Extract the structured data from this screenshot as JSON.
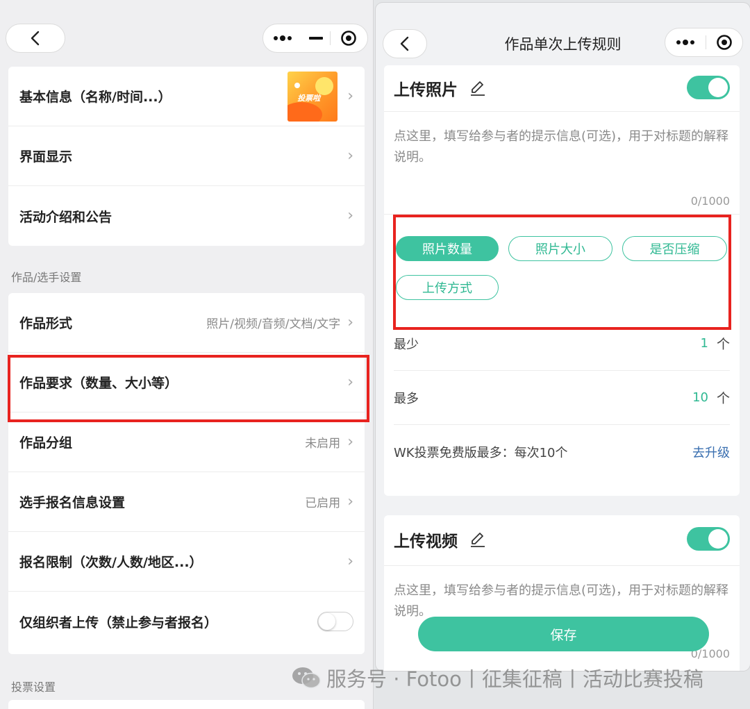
{
  "left_screen": {
    "basic_section": {
      "rows": [
        {
          "title": "基本信息（名称/时间...）"
        },
        {
          "title": "界面显示"
        },
        {
          "title": "活动介绍和公告"
        }
      ],
      "thumbnail_text": "投票啦"
    },
    "works_section_label": "作品/选手设置",
    "works_section": {
      "rows": [
        {
          "title": "作品形式",
          "value": "照片/视频/音频/文档/文字"
        },
        {
          "title": "作品要求（数量、大小等）",
          "value": ""
        },
        {
          "title": "作品分组",
          "value": "未启用"
        },
        {
          "title": "选手报名信息设置",
          "value": "已启用"
        },
        {
          "title": "报名限制（次数/人数/地区...）",
          "value": ""
        },
        {
          "title": "仅组织者上传（禁止参与者报名）",
          "value": ""
        }
      ]
    },
    "vote_section_label": "投票设置"
  },
  "right_screen": {
    "nav_title": "作品单次上传规则",
    "photo_card": {
      "title": "上传照片",
      "enabled": true,
      "hint": "点这里，填写给参与者的提示信息(可选)，用于对标题的解释说明。",
      "counter": "0/1000",
      "chips": [
        {
          "label": "照片数量",
          "active": true
        },
        {
          "label": "照片大小",
          "active": false
        },
        {
          "label": "是否压缩",
          "active": false
        },
        {
          "label": "上传方式",
          "active": false
        }
      ],
      "min_label": "最少",
      "min_value": "1",
      "max_label": "最多",
      "max_value": "10",
      "unit": "个",
      "limit_note": "WK投票免费版最多：每次10个",
      "upgrade_label": "去升级"
    },
    "video_card": {
      "title": "上传视频",
      "enabled": true,
      "hint": "点这里，填写给参与者的提示信息(可选)，用于对标题的解释说明。",
      "counter": "0/1000"
    },
    "save_label": "保存"
  },
  "watermark": "服务号 · Fotoo丨征集征稿丨活动比赛投稿",
  "colors": {
    "accent": "#3ec3a0",
    "highlight": "#e8231f",
    "link": "#3a6fb0"
  }
}
